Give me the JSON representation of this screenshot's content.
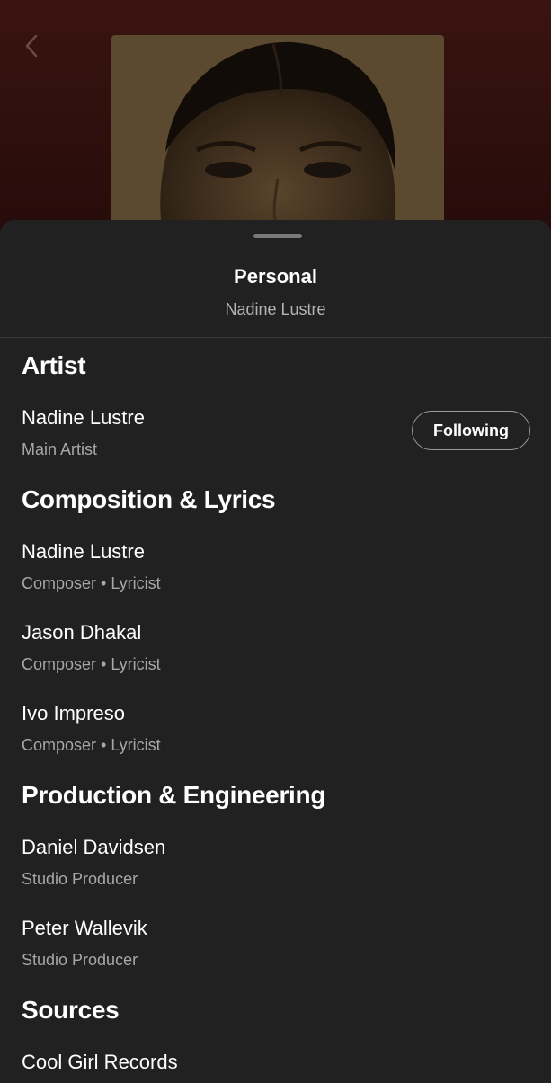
{
  "header": {
    "back_icon": "chevron-left-icon"
  },
  "sheet": {
    "title": "Personal",
    "subtitle": "Nadine Lustre"
  },
  "sections": [
    {
      "heading": "Artist",
      "credits": [
        {
          "name": "Nadine Lustre",
          "role": "Main Artist",
          "button": "Following"
        }
      ]
    },
    {
      "heading": "Composition & Lyrics",
      "credits": [
        {
          "name": "Nadine Lustre",
          "role": "Composer • Lyricist"
        },
        {
          "name": "Jason Dhakal",
          "role": "Composer • Lyricist"
        },
        {
          "name": "Ivo Impreso",
          "role": "Composer • Lyricist"
        }
      ]
    },
    {
      "heading": "Production & Engineering",
      "credits": [
        {
          "name": "Daniel Davidsen",
          "role": "Studio Producer"
        },
        {
          "name": "Peter Wallevik",
          "role": "Studio Producer"
        }
      ]
    },
    {
      "heading": "Sources",
      "credits": [
        {
          "name": "Cool Girl Records"
        }
      ]
    }
  ]
}
